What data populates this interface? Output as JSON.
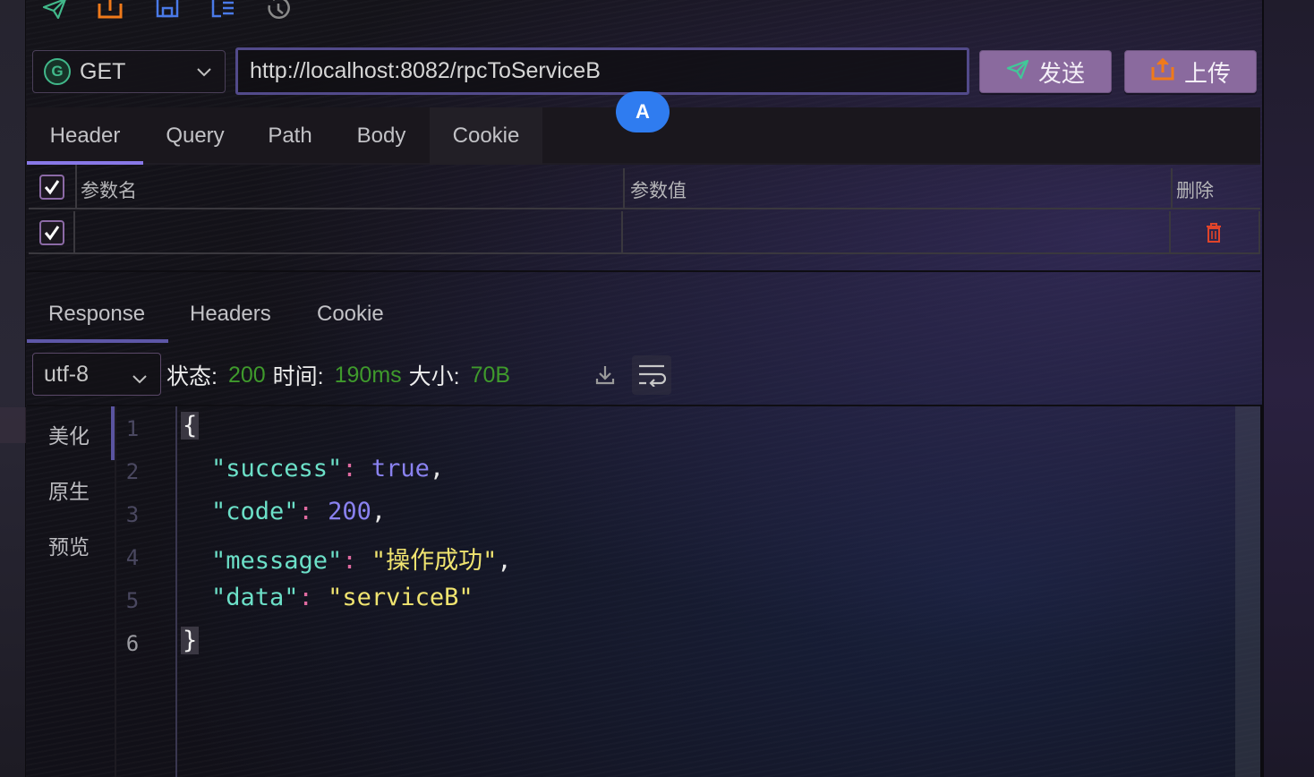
{
  "toolbar": {
    "icons": [
      "send-icon",
      "export-icon",
      "save-icon",
      "document-list-icon",
      "history-icon"
    ]
  },
  "request": {
    "method": "GET",
    "method_badge": "G",
    "url": "http://localhost:8082/rpcToServiceB",
    "send_label": "发送",
    "upload_label": "上传"
  },
  "cursor_badge": "A",
  "request_tabs": [
    {
      "label": "Header",
      "active": true
    },
    {
      "label": "Query",
      "active": false
    },
    {
      "label": "Path",
      "active": false
    },
    {
      "label": "Body",
      "active": false
    },
    {
      "label": "Cookie",
      "active": false,
      "hovered": true
    }
  ],
  "params_table": {
    "headers": {
      "name": "参数名",
      "value": "参数值",
      "delete": "删除"
    },
    "header_checked": true,
    "rows": [
      {
        "checked": true,
        "name": "",
        "value": ""
      }
    ]
  },
  "response_tabs": [
    {
      "label": "Response",
      "active": true
    },
    {
      "label": "Headers",
      "active": false
    },
    {
      "label": "Cookie",
      "active": false
    }
  ],
  "response_meta": {
    "encoding": "utf-8",
    "status_label": "状态:",
    "status_value": "200",
    "time_label": "时间:",
    "time_value": "190ms",
    "size_label": "大小:",
    "size_value": "70B"
  },
  "view_modes": [
    {
      "label": "美化",
      "active": true
    },
    {
      "label": "原生",
      "active": false
    },
    {
      "label": "预览",
      "active": false
    }
  ],
  "response_body": {
    "line_numbers": [
      "1",
      "2",
      "3",
      "4",
      "5",
      "6"
    ],
    "open_brace": "{",
    "close_brace": "}",
    "fields": [
      {
        "key": "\"success\"",
        "value": "true",
        "type": "bool",
        "comma": ","
      },
      {
        "key": "\"code\"",
        "value": "200",
        "type": "number",
        "comma": ","
      },
      {
        "key": "\"message\"",
        "value": "\"操作成功\"",
        "type": "string",
        "comma": ","
      },
      {
        "key": "\"data\"",
        "value": "\"serviceB\"",
        "type": "string",
        "comma": ""
      }
    ]
  },
  "colors": {
    "accent": "#8878e8",
    "button": "#8a6a9e",
    "status_ok": "#3f9a2c",
    "json_key": "#6ce0c8",
    "json_string": "#f0e470",
    "json_literal": "#8a82f0",
    "delete": "#e0442a"
  }
}
